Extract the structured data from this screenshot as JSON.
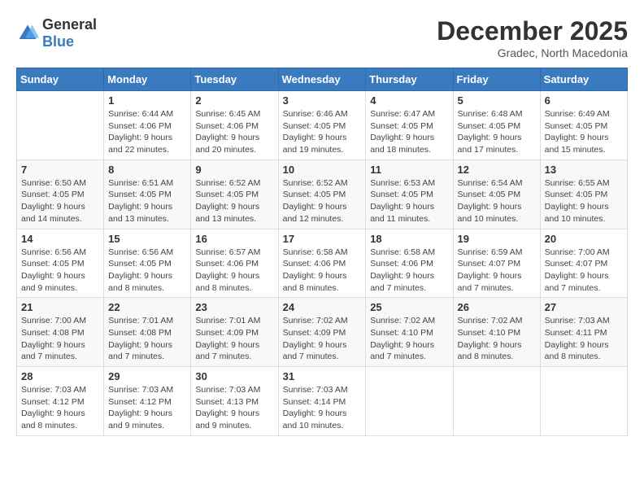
{
  "logo": {
    "text_general": "General",
    "text_blue": "Blue"
  },
  "title": "December 2025",
  "location": "Gradec, North Macedonia",
  "days_of_week": [
    "Sunday",
    "Monday",
    "Tuesday",
    "Wednesday",
    "Thursday",
    "Friday",
    "Saturday"
  ],
  "weeks": [
    [
      {
        "day": "",
        "info": ""
      },
      {
        "day": "1",
        "info": "Sunrise: 6:44 AM\nSunset: 4:06 PM\nDaylight: 9 hours and 22 minutes."
      },
      {
        "day": "2",
        "info": "Sunrise: 6:45 AM\nSunset: 4:06 PM\nDaylight: 9 hours and 20 minutes."
      },
      {
        "day": "3",
        "info": "Sunrise: 6:46 AM\nSunset: 4:05 PM\nDaylight: 9 hours and 19 minutes."
      },
      {
        "day": "4",
        "info": "Sunrise: 6:47 AM\nSunset: 4:05 PM\nDaylight: 9 hours and 18 minutes."
      },
      {
        "day": "5",
        "info": "Sunrise: 6:48 AM\nSunset: 4:05 PM\nDaylight: 9 hours and 17 minutes."
      },
      {
        "day": "6",
        "info": "Sunrise: 6:49 AM\nSunset: 4:05 PM\nDaylight: 9 hours and 15 minutes."
      }
    ],
    [
      {
        "day": "7",
        "info": "Sunrise: 6:50 AM\nSunset: 4:05 PM\nDaylight: 9 hours and 14 minutes."
      },
      {
        "day": "8",
        "info": "Sunrise: 6:51 AM\nSunset: 4:05 PM\nDaylight: 9 hours and 13 minutes."
      },
      {
        "day": "9",
        "info": "Sunrise: 6:52 AM\nSunset: 4:05 PM\nDaylight: 9 hours and 13 minutes."
      },
      {
        "day": "10",
        "info": "Sunrise: 6:52 AM\nSunset: 4:05 PM\nDaylight: 9 hours and 12 minutes."
      },
      {
        "day": "11",
        "info": "Sunrise: 6:53 AM\nSunset: 4:05 PM\nDaylight: 9 hours and 11 minutes."
      },
      {
        "day": "12",
        "info": "Sunrise: 6:54 AM\nSunset: 4:05 PM\nDaylight: 9 hours and 10 minutes."
      },
      {
        "day": "13",
        "info": "Sunrise: 6:55 AM\nSunset: 4:05 PM\nDaylight: 9 hours and 10 minutes."
      }
    ],
    [
      {
        "day": "14",
        "info": "Sunrise: 6:56 AM\nSunset: 4:05 PM\nDaylight: 9 hours and 9 minutes."
      },
      {
        "day": "15",
        "info": "Sunrise: 6:56 AM\nSunset: 4:05 PM\nDaylight: 9 hours and 8 minutes."
      },
      {
        "day": "16",
        "info": "Sunrise: 6:57 AM\nSunset: 4:06 PM\nDaylight: 9 hours and 8 minutes."
      },
      {
        "day": "17",
        "info": "Sunrise: 6:58 AM\nSunset: 4:06 PM\nDaylight: 9 hours and 8 minutes."
      },
      {
        "day": "18",
        "info": "Sunrise: 6:58 AM\nSunset: 4:06 PM\nDaylight: 9 hours and 7 minutes."
      },
      {
        "day": "19",
        "info": "Sunrise: 6:59 AM\nSunset: 4:07 PM\nDaylight: 9 hours and 7 minutes."
      },
      {
        "day": "20",
        "info": "Sunrise: 7:00 AM\nSunset: 4:07 PM\nDaylight: 9 hours and 7 minutes."
      }
    ],
    [
      {
        "day": "21",
        "info": "Sunrise: 7:00 AM\nSunset: 4:08 PM\nDaylight: 9 hours and 7 minutes."
      },
      {
        "day": "22",
        "info": "Sunrise: 7:01 AM\nSunset: 4:08 PM\nDaylight: 9 hours and 7 minutes."
      },
      {
        "day": "23",
        "info": "Sunrise: 7:01 AM\nSunset: 4:09 PM\nDaylight: 9 hours and 7 minutes."
      },
      {
        "day": "24",
        "info": "Sunrise: 7:02 AM\nSunset: 4:09 PM\nDaylight: 9 hours and 7 minutes."
      },
      {
        "day": "25",
        "info": "Sunrise: 7:02 AM\nSunset: 4:10 PM\nDaylight: 9 hours and 7 minutes."
      },
      {
        "day": "26",
        "info": "Sunrise: 7:02 AM\nSunset: 4:10 PM\nDaylight: 9 hours and 8 minutes."
      },
      {
        "day": "27",
        "info": "Sunrise: 7:03 AM\nSunset: 4:11 PM\nDaylight: 9 hours and 8 minutes."
      }
    ],
    [
      {
        "day": "28",
        "info": "Sunrise: 7:03 AM\nSunset: 4:12 PM\nDaylight: 9 hours and 8 minutes."
      },
      {
        "day": "29",
        "info": "Sunrise: 7:03 AM\nSunset: 4:12 PM\nDaylight: 9 hours and 9 minutes."
      },
      {
        "day": "30",
        "info": "Sunrise: 7:03 AM\nSunset: 4:13 PM\nDaylight: 9 hours and 9 minutes."
      },
      {
        "day": "31",
        "info": "Sunrise: 7:03 AM\nSunset: 4:14 PM\nDaylight: 9 hours and 10 minutes."
      },
      {
        "day": "",
        "info": ""
      },
      {
        "day": "",
        "info": ""
      },
      {
        "day": "",
        "info": ""
      }
    ]
  ]
}
